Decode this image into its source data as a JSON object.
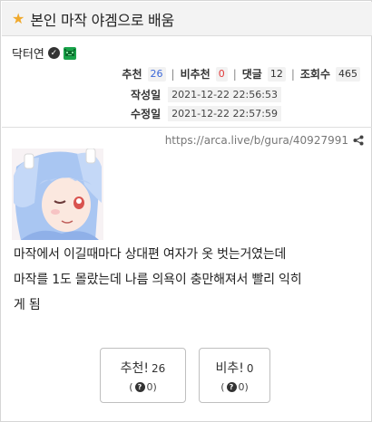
{
  "post": {
    "title": "본인 마작 야겜으로 배움",
    "author": "닥터연",
    "url": "https://arca.live/b/gura/40927991",
    "body_lines": [
      "마작에서 이길때마다 상대편 여자가 옷 벗는거였는데",
      "마작를 1도 몰랐는데 나름 의욕이 충만해져서 빨리 익히",
      "게 됨"
    ]
  },
  "stats": {
    "recommend_label": "추천",
    "recommend_count": "26",
    "not_recommend_label": "비추천",
    "not_recommend_count": "0",
    "comments_label": "댓글",
    "comments_count": "12",
    "views_label": "조회수",
    "views_count": "465",
    "separator": "|"
  },
  "dates": {
    "created_label": "작성일",
    "created": "2021-12-22 22:56:53",
    "modified_label": "수정일",
    "modified": "2021-12-22 22:57:59"
  },
  "votes": {
    "up_label": "추천!",
    "up_count": "26",
    "up_unknown_open": "(",
    "up_unknown": "0)",
    "down_label": "비추!",
    "down_count": "0",
    "down_unknown_open": "(",
    "down_unknown": "0)"
  },
  "colors": {
    "star": "#f0a92c",
    "recommend_count": "#3b68d9",
    "not_recommend_count": "#e23b3b",
    "badge_green": "#19a34a"
  },
  "icons": [
    "star-icon",
    "verified-check-icon",
    "user-badge-icon",
    "share-icon",
    "question-icon"
  ]
}
